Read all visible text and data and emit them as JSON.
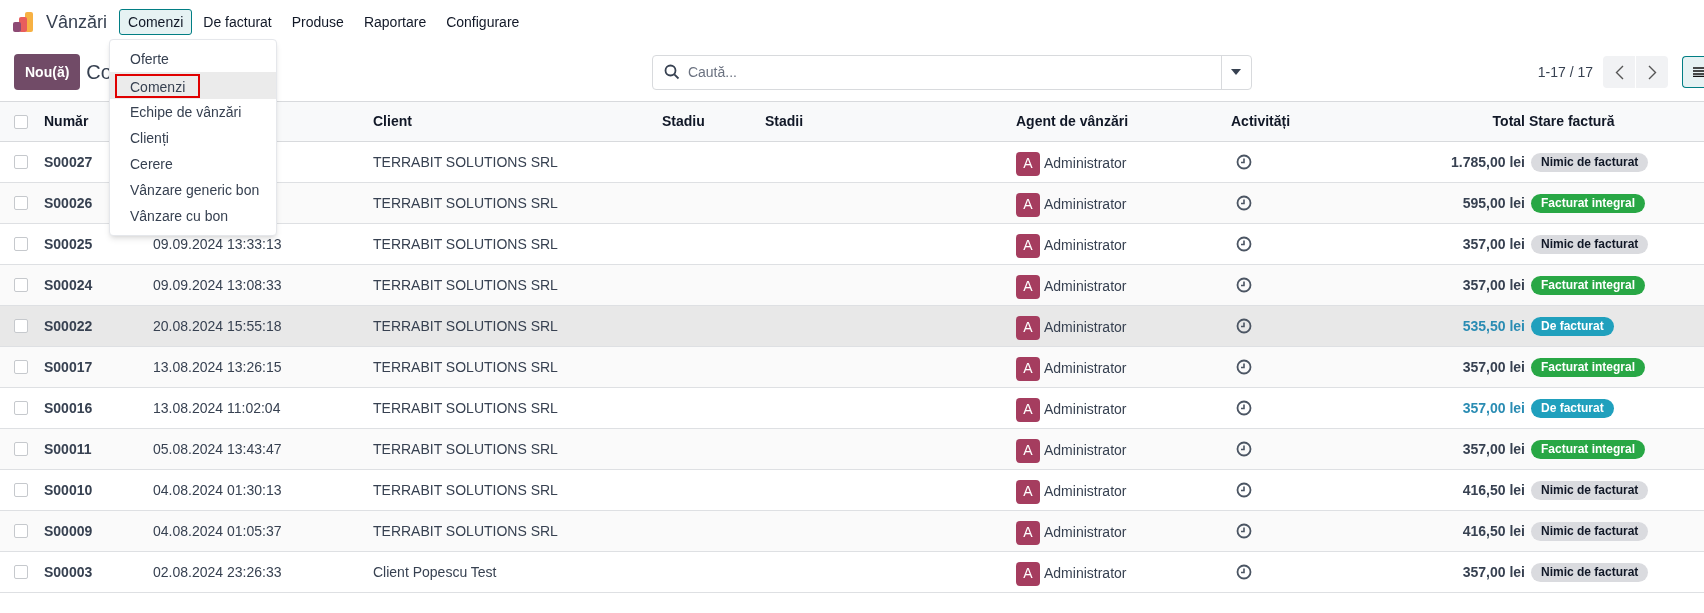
{
  "app": {
    "name": "Vânzări"
  },
  "nav": [
    {
      "label": "Comenzi",
      "selected": true
    },
    {
      "label": "De facturat",
      "selected": false
    },
    {
      "label": "Produse",
      "selected": false
    },
    {
      "label": "Raportare",
      "selected": false
    },
    {
      "label": "Configurare",
      "selected": false
    }
  ],
  "menu": [
    {
      "label": "Oferte",
      "selected": false
    },
    {
      "label": "Comenzi",
      "selected": true
    },
    {
      "label": "Echipe de vânzări",
      "selected": false
    },
    {
      "label": "Clienți",
      "selected": false
    },
    {
      "label": "Cerere",
      "selected": false
    },
    {
      "label": "Vânzare generic bon",
      "selected": false
    },
    {
      "label": "Vânzare cu bon",
      "selected": false
    }
  ],
  "new_button": "Nou(ă)",
  "breadcrumb": "Co",
  "search": {
    "placeholder": "Caută..."
  },
  "pager": "1-17 / 17",
  "table": {
    "select_all_checked": false,
    "columns": [
      "Număr",
      "Client",
      "Stadiu",
      "Stadii",
      "Agent de vânzări",
      "Activități",
      "Total",
      "Stare factură"
    ],
    "rows": [
      {
        "number": "S00027",
        "client": "TERRABIT SOLUTIONS SRL",
        "agent_initial": "A",
        "agent": "Administrator",
        "total": "1.785,00 lei",
        "status": "Nimic de facturat",
        "kind": "nothing",
        "hovered": false
      },
      {
        "number": "S00026",
        "client": "TERRABIT SOLUTIONS SRL",
        "agent_initial": "A",
        "agent": "Administrator",
        "total": "595,00 lei",
        "status": "Facturat integral",
        "kind": "invoiced",
        "hovered": false
      },
      {
        "number": "S00025",
        "date": "09.09.2024 13:33:13",
        "client": "TERRABIT SOLUTIONS SRL",
        "agent_initial": "A",
        "agent": "Administrator",
        "total": "357,00 lei",
        "status": "Nimic de facturat",
        "kind": "nothing",
        "hovered": false
      },
      {
        "number": "S00024",
        "date": "09.09.2024 13:08:33",
        "client": "TERRABIT SOLUTIONS SRL",
        "agent_initial": "A",
        "agent": "Administrator",
        "total": "357,00 lei",
        "status": "Facturat integral",
        "kind": "invoiced",
        "hovered": false
      },
      {
        "number": "S00022",
        "date": "20.08.2024 15:55:18",
        "client": "TERRABIT SOLUTIONS SRL",
        "agent_initial": "A",
        "agent": "Administrator",
        "total": "535,50 lei",
        "status": "De facturat",
        "kind": "to_invoice",
        "hovered": true
      },
      {
        "number": "S00017",
        "date": "13.08.2024 13:26:15",
        "client": "TERRABIT SOLUTIONS SRL",
        "agent_initial": "A",
        "agent": "Administrator",
        "total": "357,00 lei",
        "status": "Facturat integral",
        "kind": "invoiced",
        "hovered": false
      },
      {
        "number": "S00016",
        "date": "13.08.2024 11:02:04",
        "client": "TERRABIT SOLUTIONS SRL",
        "agent_initial": "A",
        "agent": "Administrator",
        "total": "357,00 lei",
        "status": "De facturat",
        "kind": "to_invoice",
        "hovered": false
      },
      {
        "number": "S00011",
        "date": "05.08.2024 13:43:47",
        "client": "TERRABIT SOLUTIONS SRL",
        "agent_initial": "A",
        "agent": "Administrator",
        "total": "357,00 lei",
        "status": "Facturat integral",
        "kind": "invoiced",
        "hovered": false
      },
      {
        "number": "S00010",
        "date": "04.08.2024 01:30:13",
        "client": "TERRABIT SOLUTIONS SRL",
        "agent_initial": "A",
        "agent": "Administrator",
        "total": "416,50 lei",
        "status": "Nimic de facturat",
        "kind": "nothing",
        "hovered": false
      },
      {
        "number": "S00009",
        "date": "04.08.2024 01:05:37",
        "client": "TERRABIT SOLUTIONS SRL",
        "agent_initial": "A",
        "agent": "Administrator",
        "total": "416,50 lei",
        "status": "Nimic de facturat",
        "kind": "nothing",
        "hovered": false
      },
      {
        "number": "S00003",
        "date": "02.08.2024 23:26:33",
        "client": "Client Popescu Test",
        "agent_initial": "A",
        "agent": "Administrator",
        "total": "357,00 lei",
        "status": "Nimic de facturat",
        "kind": "nothing",
        "hovered": false
      }
    ]
  }
}
